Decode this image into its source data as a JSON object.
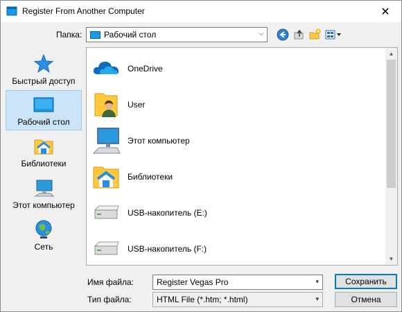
{
  "window": {
    "title": "Register From Another Computer",
    "close_glyph": "✕"
  },
  "toolbar": {
    "folder_label": "Папка:",
    "folder_value": "Рабочий стол",
    "icons": [
      "back-icon",
      "up-folder-icon",
      "new-folder-icon",
      "view-menu-icon"
    ]
  },
  "places": [
    {
      "label": "Быстрый доступ",
      "icon": "star-icon",
      "selected": false
    },
    {
      "label": "Рабочий стол",
      "icon": "desktop-icon",
      "selected": true
    },
    {
      "label": "Библиотеки",
      "icon": "libraries-icon",
      "selected": false
    },
    {
      "label": "Этот компьютер",
      "icon": "computer-icon",
      "selected": false
    },
    {
      "label": "Сеть",
      "icon": "network-icon",
      "selected": false
    }
  ],
  "files": [
    {
      "name": "OneDrive",
      "icon": "cloud-icon"
    },
    {
      "name": "User",
      "icon": "user-folder-icon"
    },
    {
      "name": "Этот компьютер",
      "icon": "computer-icon"
    },
    {
      "name": "Библиотеки",
      "icon": "libraries-icon"
    },
    {
      "name": "USB-накопитель (E:)",
      "icon": "drive-icon"
    },
    {
      "name": "USB-накопитель (F:)",
      "icon": "drive-icon"
    }
  ],
  "filename": {
    "label": "Имя файла:",
    "value": "Register Vegas Pro"
  },
  "filetype": {
    "label": "Тип файла:",
    "value": "HTML File (*.htm; *.html)"
  },
  "buttons": {
    "save": "Сохранить",
    "cancel": "Отмена"
  },
  "colors": {
    "accent": "#0078d7",
    "selected_bg": "#cce4f7",
    "folder": "#ffc83d"
  }
}
